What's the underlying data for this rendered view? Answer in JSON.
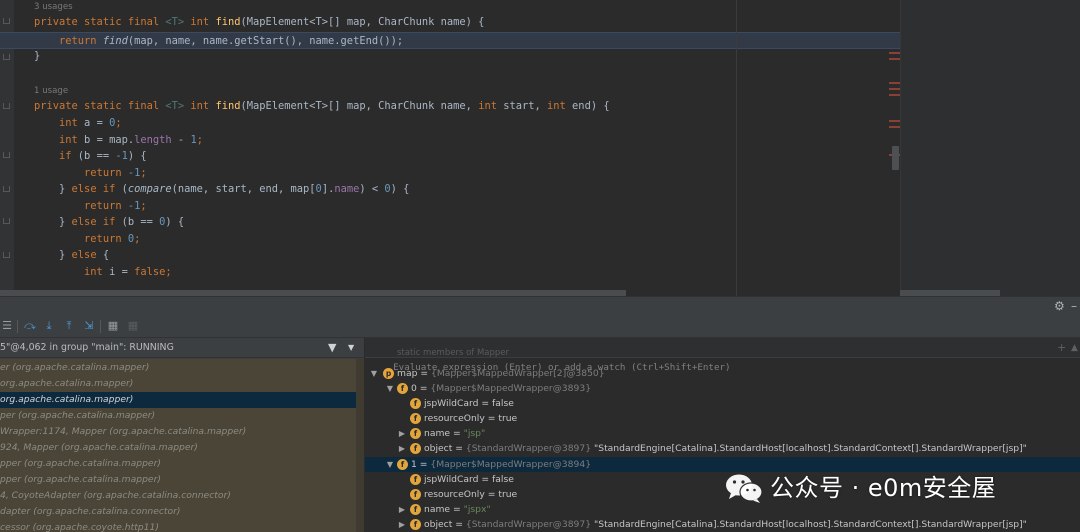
{
  "editor": {
    "usages1": "3 usages",
    "usages2": "1 usage",
    "lines": {
      "l1": {
        "a": "private static final ",
        "b": "<T>",
        "c": " int ",
        "d": "find",
        "e": "(MapElement<T>[] map, CharChunk name) {"
      },
      "l2": {
        "a": "    return ",
        "b": "find",
        "c": "(map, name, name.getStart(), name.getEnd());"
      },
      "l3": {
        "a": "}"
      },
      "l4": {
        "a": "private static final ",
        "b": "<T>",
        "c": " int ",
        "d": "find",
        "e": "(MapElement<T>[] map, CharChunk name, ",
        "f": "int",
        "g": " start, ",
        "h": "int",
        "i": " end) {"
      },
      "l5": {
        "a": "    int",
        "b": " a = ",
        "c": "0",
        "d": ";"
      },
      "l6": {
        "a": "    int",
        "b": " b = map.",
        "c": "length",
        "d": " - ",
        "e": "1",
        "f": ";"
      },
      "l7": {
        "a": "    if",
        "b": " (b == ",
        "c": "-1",
        "d": ") {"
      },
      "l8": {
        "a": "        return ",
        "b": "-1",
        "c": ";"
      },
      "l9": {
        "a": "    } ",
        "b": "else if",
        "c": " (",
        "d": "compare",
        "e": "(name, start, end, map[",
        "f": "0",
        "g": "].",
        "h": "name",
        "i": ") < ",
        "j": "0",
        "k": ") {"
      },
      "l10": {
        "a": "        return ",
        "b": "-1",
        "c": ";"
      },
      "l11": {
        "a": "    } ",
        "b": "else if",
        "c": " (b == ",
        "d": "0",
        "e": ") {"
      },
      "l12": {
        "a": "        return ",
        "b": "0",
        "c": ";"
      },
      "l13": {
        "a": "    } ",
        "b": "else",
        "c": " {"
      },
      "l14": {
        "a": "        int",
        "b": " i = ",
        "c": "false",
        "d": ";"
      }
    }
  },
  "debugger": {
    "thread": "5\"@4,062 in group \"main\": RUNNING",
    "frames": [
      "er (org.apache.catalina.mapper)",
      "org.apache.catalina.mapper)",
      "org.apache.catalina.mapper)",
      "per (org.apache.catalina.mapper)",
      "Wrapper:1174, Mapper (org.apache.catalina.mapper)",
      "924, Mapper (org.apache.catalina.mapper)",
      "pper (org.apache.catalina.mapper)",
      "pper (org.apache.catalina.mapper)",
      "4, CoyoteAdapter (org.apache.catalina.connector)",
      "dapter (org.apache.catalina.connector)",
      "cessor (org.apache.coyote.http11)"
    ],
    "eval_placeholder": "Evaluate expression (Enter) or add a watch (Ctrl+Shift+Enter)",
    "ghost_text": "static members of Mapper",
    "vars": {
      "map": {
        "name": "map",
        "eq": " = ",
        "type": "{Mapper$MappedWrapper[2]@3850}"
      },
      "e0": {
        "name": "0",
        "eq": " = ",
        "type": "{Mapper$MappedWrapper@3893}"
      },
      "e0_jsp": {
        "name": "jspWildCard",
        "eq": " = ",
        "val": "false"
      },
      "e0_res": {
        "name": "resourceOnly",
        "eq": " = ",
        "val": "true"
      },
      "e0_name": {
        "name": "name",
        "eq": " = ",
        "val": "\"jsp\""
      },
      "e0_obj": {
        "name": "object",
        "eq": " = ",
        "type": "{StandardWrapper@3897}",
        "val": " \"StandardEngine[Catalina].StandardHost[localhost].StandardContext[].StandardWrapper[jsp]\""
      },
      "e1": {
        "name": "1",
        "eq": " = ",
        "type": "{Mapper$MappedWrapper@3894}"
      },
      "e1_jsp": {
        "name": "jspWildCard",
        "eq": " = ",
        "val": "false"
      },
      "e1_res": {
        "name": "resourceOnly",
        "eq": " = ",
        "val": "true"
      },
      "e1_name": {
        "name": "name",
        "eq": " = ",
        "val": "\"jspx\""
      },
      "e1_obj": {
        "name": "object",
        "eq": " = ",
        "type": "{StandardWrapper@3897}",
        "val": " \"StandardEngine[Catalina].StandardHost[localhost].StandardContext[].StandardWrapper[jsp]\""
      }
    }
  },
  "watermark": {
    "text": "公众号 · e0m安全屋"
  }
}
